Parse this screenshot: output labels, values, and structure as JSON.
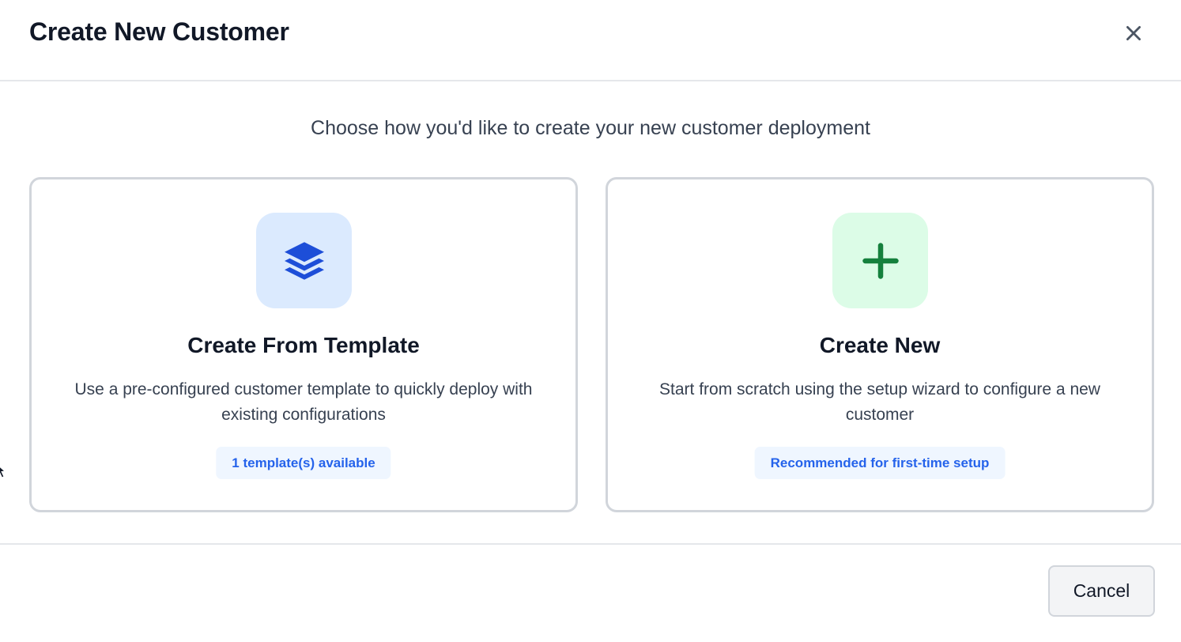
{
  "dialog": {
    "title": "Create New Customer",
    "close_icon": "close-icon"
  },
  "body": {
    "subtitle": "Choose how you'd like to create your new customer deployment"
  },
  "options": [
    {
      "icon": "layers-icon",
      "title": "Create From Template",
      "description": "Use a pre-configured customer template to quickly deploy with existing configurations",
      "badge": "1 template(s) available",
      "accent_color": "#2563eb",
      "icon_bg": "#dbeafe"
    },
    {
      "icon": "plus-icon",
      "title": "Create New",
      "description": "Start from scratch using the setup wizard to configure a new customer",
      "badge": "Recommended for first-time setup",
      "accent_color": "#15803d",
      "icon_bg": "#dcfce7"
    }
  ],
  "footer": {
    "cancel_label": "Cancel"
  },
  "colors": {
    "border": "#d1d5db",
    "badge_bg": "#eff6ff",
    "badge_text": "#2563eb"
  }
}
